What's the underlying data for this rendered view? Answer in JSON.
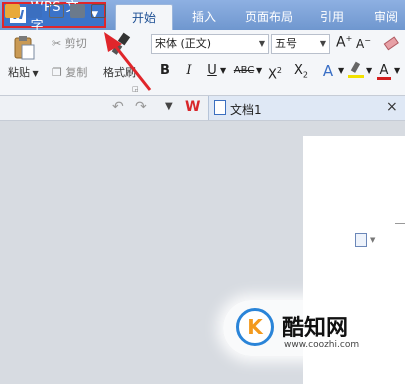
{
  "app": {
    "menu_button_label": "WPS 文字",
    "logo_letter": "W"
  },
  "tabs": [
    {
      "label": "开始",
      "active": true
    },
    {
      "label": "插入",
      "active": false
    },
    {
      "label": "页面布局",
      "active": false
    },
    {
      "label": "引用",
      "active": false
    },
    {
      "label": "审阅",
      "active": false
    }
  ],
  "ribbon": {
    "paste_label": "粘贴",
    "cut_label": "剪切",
    "copy_label": "复制",
    "format_painter_label": "格式刷",
    "font_name": "宋体 (正文)",
    "font_size": "五号",
    "grow_font": "A",
    "shrink_font": "A",
    "bold": "B",
    "italic": "I",
    "underline": "U",
    "strike": "ABC",
    "superscript": "X",
    "sup_mark": "2",
    "subscript": "X",
    "sub_mark": "2",
    "text_effect": "A",
    "font_color": "A"
  },
  "document_tab": {
    "title": "文档1",
    "close": "×"
  },
  "watermark": {
    "site": "酷知网",
    "url": "www.coozhi.com"
  },
  "colors": {
    "accent": "#3b73c9",
    "highlight_border": "#e0262b",
    "arrow": "#e0262b"
  }
}
